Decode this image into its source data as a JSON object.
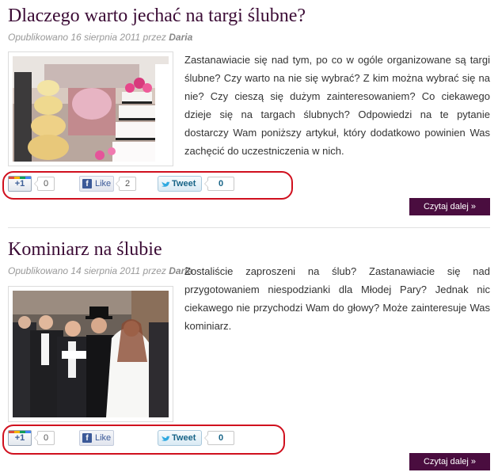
{
  "posts": [
    {
      "title": "Dlaczego warto jechać na targi ślubne?",
      "meta_prefix": "Opublikowano 16 sierpnia 2011 przez",
      "author": "Daria",
      "excerpt": "Zastanawiacie się nad tym, po co w ogóle organizowane są targi ślubne? Czy warto na nie się wybrać? Z kim można wybrać się na nie? Czy cieszą się dużym zainteresowaniem? Co ciekawego dzieje się na targach ślubnych? Odpowiedzi na te pytanie dostarczy Wam poniższy artykuł, który dodatkowo powinien Was zachęcić do uczestniczenia w nich.",
      "image_icon": "wedding-cakes-photo",
      "gplus_label": "+1",
      "gplus_count": "0",
      "like_label": "Like",
      "like_count": "2",
      "tweet_label": "Tweet",
      "tweet_count": "0",
      "read_more": "Czytaj dalej »"
    },
    {
      "title": "Kominiarz na ślubie",
      "meta_prefix": "Opublikowano 14 sierpnia 2011 przez",
      "author": "Daria",
      "excerpt": "Zostaliście zaproszeni na ślub? Zastanawiacie się nad przygotowaniem niespodzianki dla Młodej Pary? Jednak nic ciekawego nie przychodzi Wam do głowy? Może zainteresuje Was kominiarz.",
      "image_icon": "wedding-chimney-sweep-photo",
      "gplus_label": "+1",
      "gplus_count": "0",
      "like_label": "Like",
      "tweet_label": "Tweet",
      "tweet_count": "0",
      "read_more": "Czytaj dalej »"
    }
  ],
  "colors": {
    "title": "#3b0b35",
    "read_more_bg": "#4a0d3f",
    "highlight_ring": "#d0101e"
  }
}
